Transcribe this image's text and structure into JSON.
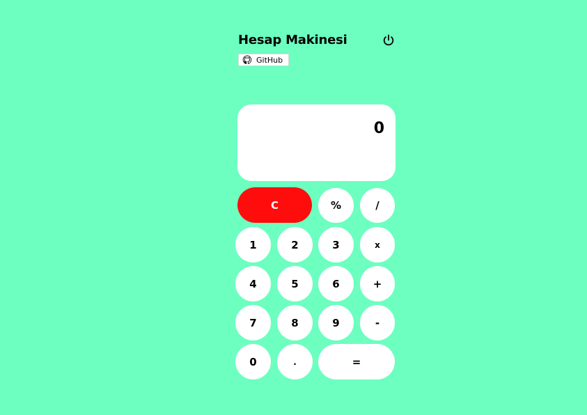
{
  "header": {
    "title": "Hesap Makinesi",
    "github_label": "GitHub"
  },
  "display": {
    "value": "0"
  },
  "keys": {
    "clear": "C",
    "percent": "%",
    "divide": "/",
    "one": "1",
    "two": "2",
    "three": "3",
    "multiply": "x",
    "four": "4",
    "five": "5",
    "six": "6",
    "plus": "+",
    "seven": "7",
    "eight": "8",
    "nine": "9",
    "minus": "-",
    "zero": "0",
    "decimal": ".",
    "equals": "="
  },
  "colors": {
    "background": "#6cffc0",
    "clear_button": "#ff0d0d",
    "button": "#ffffff"
  },
  "icons": {
    "power": "power-icon",
    "github": "github-icon"
  }
}
